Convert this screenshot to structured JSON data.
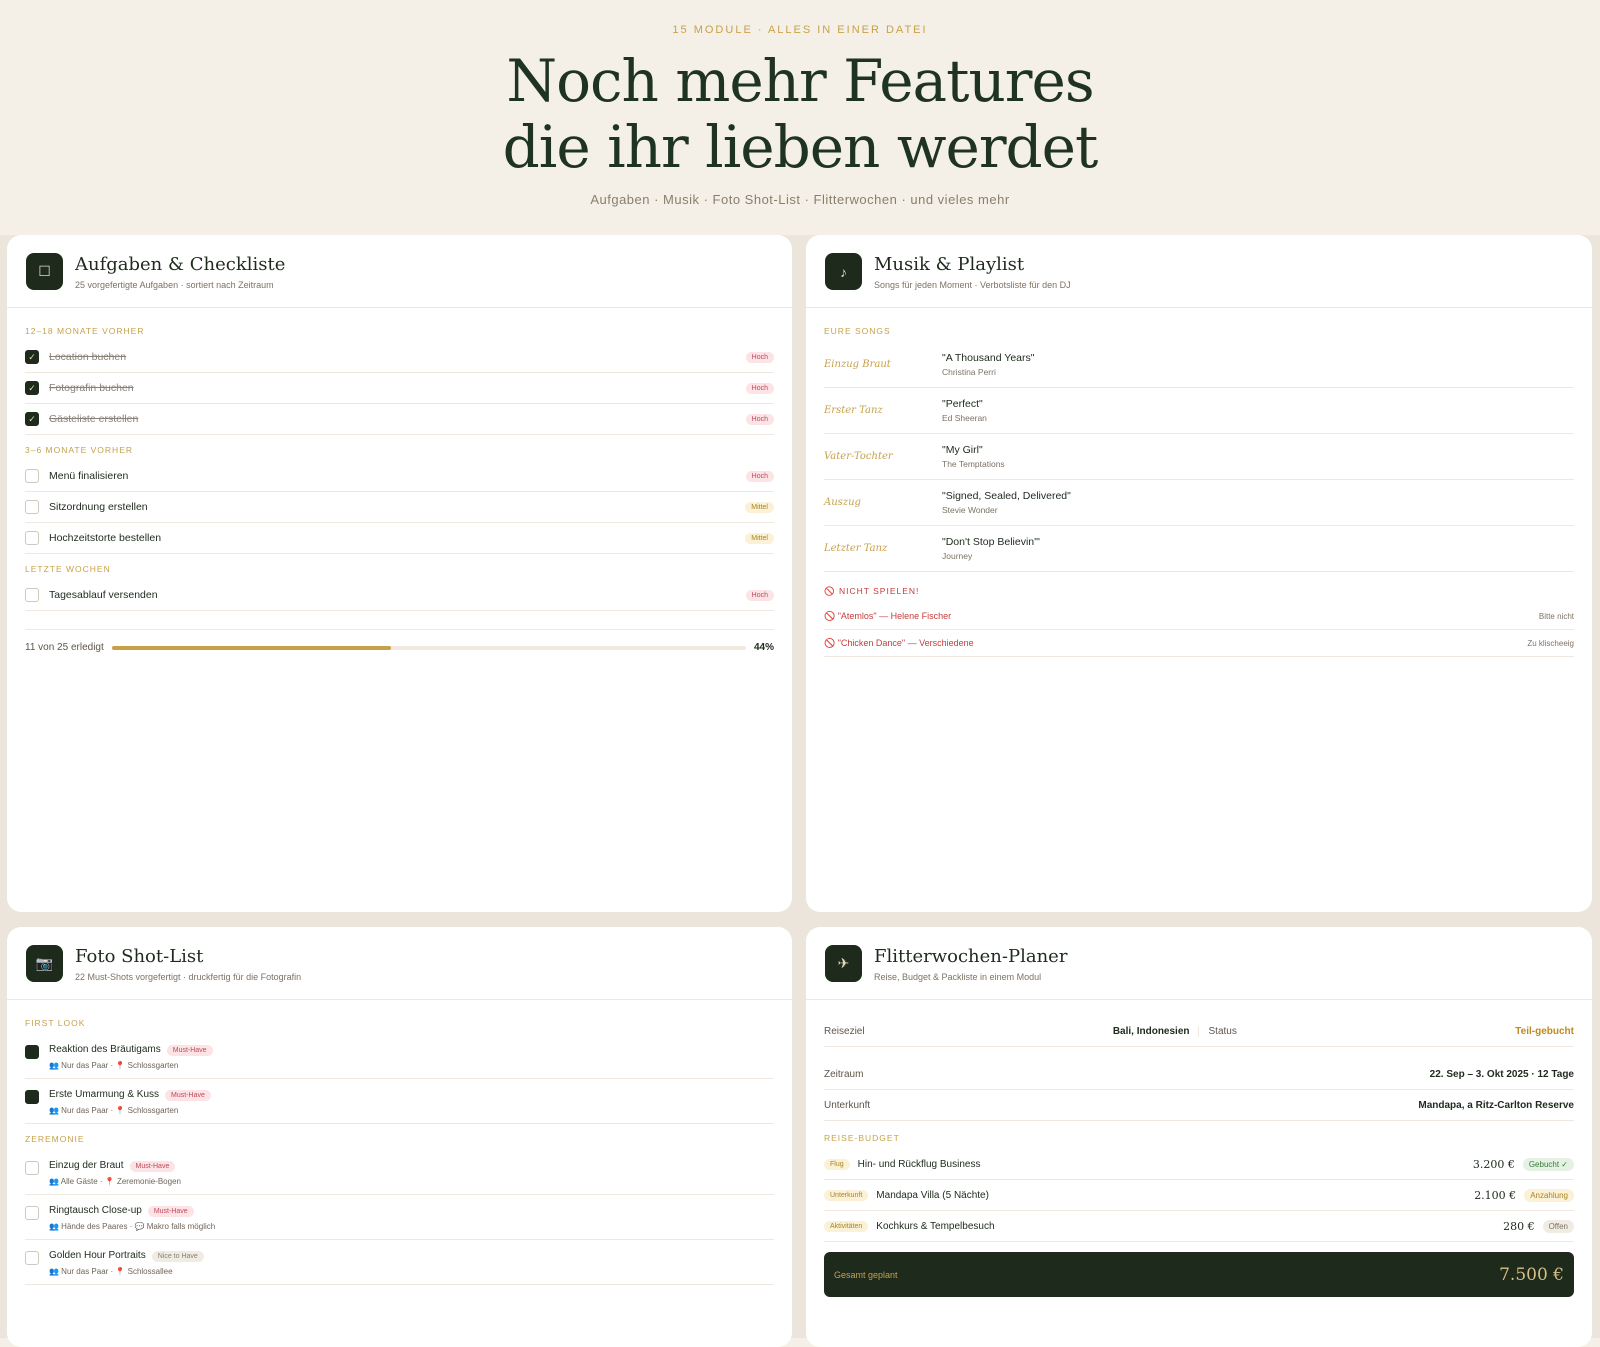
{
  "hero": {
    "eyebrow": "15 MODULE · ALLES IN EINER DATEI",
    "title_line1": "Noch mehr Features",
    "title_line2": "die ihr lieben werdet",
    "subtitle": "Aufgaben · Musik · Foto Shot-List · Flitterwochen · und vieles mehr"
  },
  "tasks": {
    "icon": "☐",
    "title": "Aufgaben & Checkliste",
    "subtitle": "25 vorgefertigte Aufgaben · sortiert nach Zeitraum",
    "groups": [
      {
        "label": "12–18 MONATE VORHER",
        "items": [
          {
            "label": "Location buchen",
            "done": true,
            "priority": "Hoch"
          },
          {
            "label": "Fotografin buchen",
            "done": true,
            "priority": "Hoch"
          },
          {
            "label": "Gästeliste erstellen",
            "done": true,
            "priority": "Hoch"
          }
        ]
      },
      {
        "label": "3–6 MONATE VORHER",
        "items": [
          {
            "label": "Menü finalisieren",
            "done": false,
            "priority": "Hoch"
          },
          {
            "label": "Sitzordnung erstellen",
            "done": false,
            "priority": "Mittel"
          },
          {
            "label": "Hochzeitstorte bestellen",
            "done": false,
            "priority": "Mittel"
          }
        ]
      },
      {
        "label": "LETZTE WOCHEN",
        "items": [
          {
            "label": "Tagesablauf versenden",
            "done": false,
            "priority": "Hoch"
          }
        ]
      }
    ],
    "progress_text": "11 von 25 erledigt",
    "progress_value": 0.44,
    "progress_pct": "44%"
  },
  "music": {
    "icon": "♪",
    "title": "Musik & Playlist",
    "subtitle": "Songs für jeden Moment · Verbotsliste für den DJ",
    "songs_label": "EURE SONGS",
    "songs": [
      {
        "moment": "Einzug Braut",
        "title": "\"A Thousand Years\"",
        "artist": "Christina Perri"
      },
      {
        "moment": "Erster Tanz",
        "title": "\"Perfect\"",
        "artist": "Ed Sheeran"
      },
      {
        "moment": "Vater-Tochter",
        "title": "\"My Girl\"",
        "artist": "The Temptations"
      },
      {
        "moment": "Auszug",
        "title": "\"Signed, Sealed, Delivered\"",
        "artist": "Stevie Wonder"
      },
      {
        "moment": "Letzter Tanz",
        "title": "\"Don't Stop Believin'\"",
        "artist": "Journey"
      }
    ],
    "ban_label": "🚫 NICHT SPIELEN!",
    "banned": [
      {
        "song": "🚫 \"Atemlos\" — Helene Fischer",
        "note": "Bitte nicht"
      },
      {
        "song": "🚫 \"Chicken Dance\" — Verschiedene",
        "note": "Zu klischeeig"
      }
    ]
  },
  "photos": {
    "icon": "📷",
    "title": "Foto Shot-List",
    "subtitle": "22 Must-Shots vorgefertigt · druckfertig für die Fotografin",
    "groups": [
      {
        "label": "FIRST LOOK",
        "items": [
          {
            "title": "Reaktion des Bräutigams",
            "tag": "Must-Have",
            "tag_kind": "must",
            "meta": "👥 Nur das Paar · 📍 Schlossgarten",
            "done": true
          },
          {
            "title": "Erste Umarmung & Kuss",
            "tag": "Must-Have",
            "tag_kind": "must",
            "meta": "👥 Nur das Paar · 📍 Schlossgarten",
            "done": true
          }
        ]
      },
      {
        "label": "ZEREMONIE",
        "items": [
          {
            "title": "Einzug der Braut",
            "tag": "Must-Have",
            "tag_kind": "must",
            "meta": "👥 Alle Gäste · 📍 Zeremonie-Bogen",
            "done": false
          },
          {
            "title": "Ringtausch Close-up",
            "tag": "Must-Have",
            "tag_kind": "must",
            "meta": "👥 Hände des Paares · 💬 Makro falls möglich",
            "done": false
          },
          {
            "title": "Golden Hour Portraits",
            "tag": "Nice to Have",
            "tag_kind": "nice",
            "meta": "👥 Nur das Paar · 📍 Schlossallee",
            "done": false
          }
        ]
      }
    ]
  },
  "honeymoon": {
    "icon": "✈",
    "title": "Flitterwochen-Planer",
    "subtitle": "Reise, Budget & Packliste in einem Modul",
    "destination_label": "Reiseziel",
    "destination": "Bali, Indonesien",
    "status_label": "Status",
    "status": "Teil-gebucht",
    "period_label": "Zeitraum",
    "period": "22. Sep – 3. Okt 2025 · 12 Tage",
    "stay_label": "Unterkunft",
    "stay": "Mandapa, a Ritz-Carlton Reserve",
    "budget_label": "REISE-BUDGET",
    "budget": [
      {
        "cat": "Flug",
        "item": "Hin- und Rückflug Business",
        "amount": "3.200 €",
        "status": "Gebucht ✓",
        "kind": "ok"
      },
      {
        "cat": "Unterkunft",
        "item": "Mandapa Villa (5 Nächte)",
        "amount": "2.100 €",
        "status": "Anzahlung",
        "kind": "an"
      },
      {
        "cat": "Aktivitäten",
        "item": "Kochkurs & Tempelbesuch",
        "amount": "280 €",
        "status": "Offen",
        "kind": "of"
      }
    ],
    "total_label": "Gesamt geplant",
    "total": "7.500 €"
  }
}
